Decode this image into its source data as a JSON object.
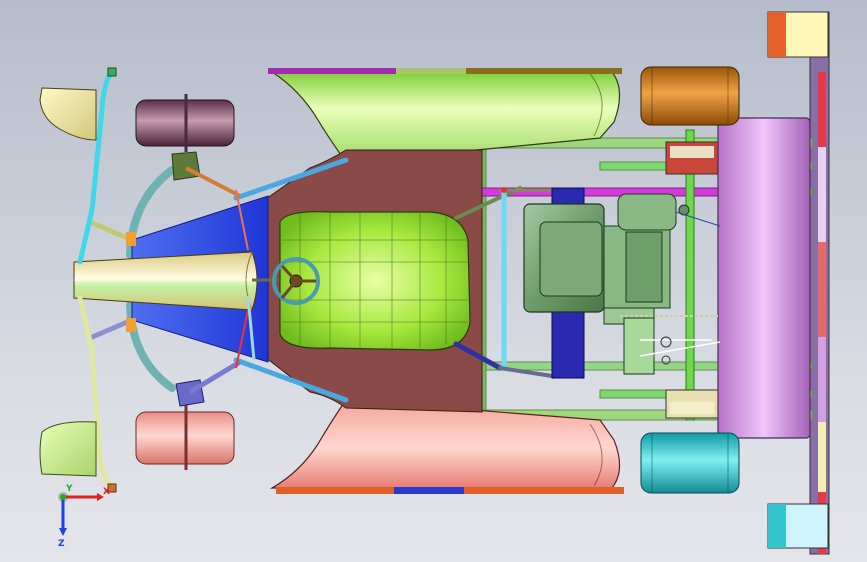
{
  "viewport": {
    "background_top": "#b6bccb",
    "background_bottom": "#e3e5ea"
  },
  "model": {
    "type": "go-kart-assembly",
    "view": "top"
  },
  "triad": {
    "x_label": "X",
    "y_label": "Y",
    "z_label": "Z",
    "x_color": "#e02020",
    "y_color": "#20b020",
    "z_color": "#2040e0"
  }
}
